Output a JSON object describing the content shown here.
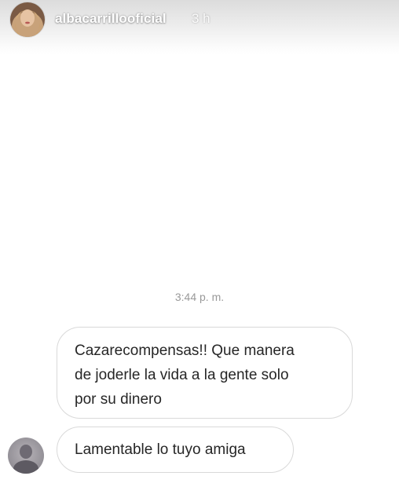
{
  "header": {
    "username": "albacarrillooficial",
    "time_ago": "3 h"
  },
  "chat": {
    "timestamp": "3:44 p. m.",
    "messages": [
      {
        "lines": [
          "Cazarecompensas!! Que manera",
          "de joderle la vida a la gente solo",
          "por su dinero"
        ]
      },
      {
        "text": "Lamentable lo tuyo amiga"
      }
    ]
  },
  "colors": {
    "bubble_border": "#d9d9d9",
    "message_text": "#262626",
    "timestamp": "#999999"
  },
  "icons": {
    "story_avatar": "profile-photo-avatar",
    "sender_avatar": "blurred-profile-avatar"
  }
}
